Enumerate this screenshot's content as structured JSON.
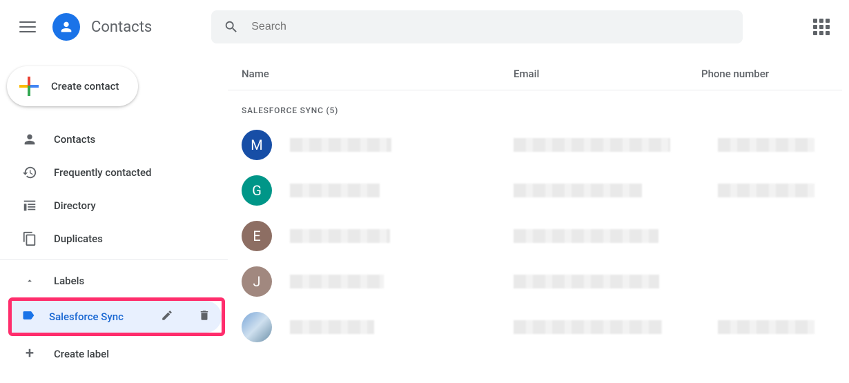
{
  "header": {
    "app_title": "Contacts",
    "search_placeholder": "Search"
  },
  "sidebar": {
    "create_contact_label": "Create contact",
    "items": [
      {
        "label": "Contacts"
      },
      {
        "label": "Frequently contacted"
      },
      {
        "label": "Directory"
      },
      {
        "label": "Duplicates"
      }
    ],
    "labels_header": "Labels",
    "active_label": "Salesforce Sync",
    "create_label": "Create label"
  },
  "main": {
    "columns": {
      "name": "Name",
      "email": "Email",
      "phone": "Phone number"
    },
    "section_title": "SALESFORCE SYNC (5)",
    "rows": [
      {
        "initial": "M",
        "color": "#174ea6"
      },
      {
        "initial": "G",
        "color": "#009688"
      },
      {
        "initial": "E",
        "color": "#8d6e63"
      },
      {
        "initial": "J",
        "color": "#a1887f"
      },
      {
        "initial": "",
        "color": "image"
      }
    ]
  }
}
